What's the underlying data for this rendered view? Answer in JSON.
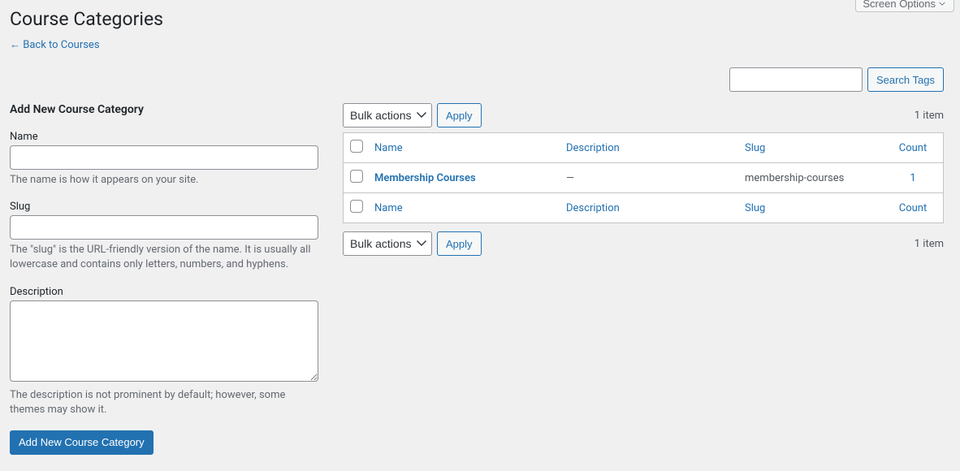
{
  "screenOptions": "Screen Options",
  "pageTitle": "Course Categories",
  "backLink": "← Back to Courses",
  "search": {
    "value": "",
    "button": "Search Tags"
  },
  "form": {
    "heading": "Add New Course Category",
    "name": {
      "label": "Name",
      "value": "",
      "help": "The name is how it appears on your site."
    },
    "slug": {
      "label": "Slug",
      "value": "",
      "help": "The \"slug\" is the URL-friendly version of the name. It is usually all lowercase and contains only letters, numbers, and hyphens."
    },
    "description": {
      "label": "Description",
      "value": "",
      "help": "The description is not prominent by default; however, some themes may show it."
    },
    "submit": "Add New Course Category"
  },
  "bulk": {
    "selectLabel": "Bulk actions",
    "apply": "Apply"
  },
  "pagination": {
    "count": "1 item"
  },
  "columns": {
    "name": "Name",
    "description": "Description",
    "slug": "Slug",
    "count": "Count"
  },
  "rows": [
    {
      "name": "Membership Courses",
      "description": "—",
      "slug": "membership-courses",
      "count": "1"
    }
  ]
}
